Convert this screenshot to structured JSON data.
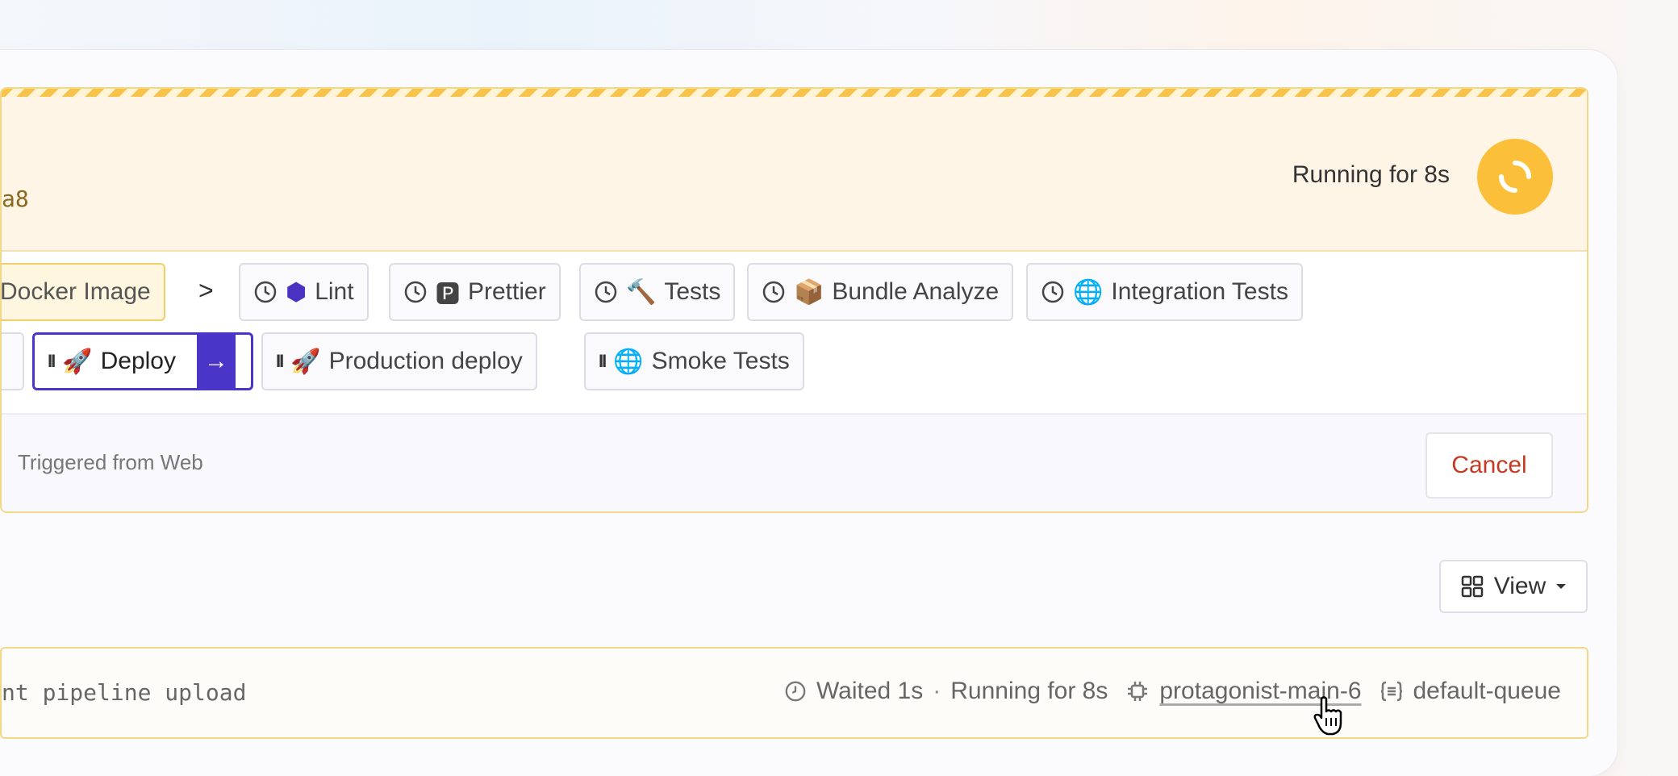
{
  "header": {
    "commit_fragment": "a8",
    "running_status": "Running for 8s"
  },
  "steps": {
    "row1": [
      {
        "label": "Docker Image",
        "state": "running"
      },
      {
        "label": "Lint",
        "emoji": "⬢",
        "state": "waiting"
      },
      {
        "label": "Prettier",
        "emoji": "🅿",
        "state": "waiting"
      },
      {
        "label": "Tests",
        "emoji": "🔨",
        "state": "waiting"
      },
      {
        "label": "Bundle Analyze",
        "emoji": "📦",
        "state": "waiting"
      },
      {
        "label": "Integration Tests",
        "emoji": "🌐",
        "state": "waiting"
      }
    ],
    "row2": [
      {
        "label": "Deploy",
        "emoji": "🚀",
        "state": "blocked",
        "selected": true
      },
      {
        "label": "Production deploy",
        "emoji": "🚀",
        "state": "blocked"
      },
      {
        "label": "Smoke Tests",
        "emoji": "🌐",
        "state": "blocked"
      }
    ]
  },
  "footer": {
    "triggered_text": "Triggered from Web",
    "cancel_label": "Cancel"
  },
  "toolbar": {
    "view_label": "View"
  },
  "job": {
    "command_fragment": "nt pipeline upload",
    "waited": "Waited 1s",
    "separator": "·",
    "running": "Running for 8s",
    "agent": "protagonist-main-6",
    "queue": "default-queue"
  },
  "colors": {
    "accent": "#4a35c9",
    "running": "#fcbf3a",
    "cancel": "#c23b22"
  }
}
